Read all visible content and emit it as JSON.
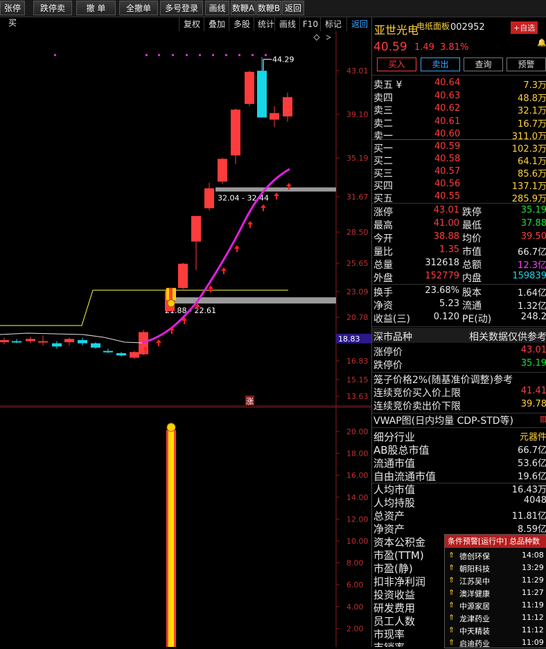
{
  "toolbar": [
    "张停买",
    "跌停卖",
    "撤 单",
    "全撤单",
    "多号登录",
    "画线",
    "数鞭A",
    "数鞭B",
    "返回"
  ],
  "subtoolbar": [
    "复权",
    "叠加",
    "多股",
    "统计",
    "画线",
    "F10",
    "标记",
    "返回"
  ],
  "chart_data": {
    "type": "candlestick",
    "y_ticks": [
      "43.01",
      "39.10",
      "35.19",
      "31.67",
      "28.50",
      "25.65",
      "23.09",
      "20.78",
      "18.70",
      "16.83",
      "15.15",
      "13.63"
    ],
    "current_price_tag": "18.83",
    "candles": [
      {
        "o": 18.5,
        "h": 18.9,
        "l": 18.3,
        "c": 18.7
      },
      {
        "o": 18.6,
        "h": 18.8,
        "l": 18.4,
        "c": 18.5
      },
      {
        "o": 18.6,
        "h": 19.0,
        "l": 18.4,
        "c": 18.8
      },
      {
        "o": 18.5,
        "h": 19.1,
        "l": 18.2,
        "c": 18.6
      },
      {
        "o": 18.4,
        "h": 18.6,
        "l": 17.9,
        "c": 18.1
      },
      {
        "o": 18.5,
        "h": 18.9,
        "l": 18.2,
        "c": 18.8
      },
      {
        "o": 18.7,
        "h": 18.9,
        "l": 18.2,
        "c": 18.4
      },
      {
        "o": 18.4,
        "h": 18.5,
        "l": 17.9,
        "c": 18.0
      },
      {
        "o": 17.7,
        "h": 17.9,
        "l": 17.5,
        "c": 17.6
      },
      {
        "o": 17.5,
        "h": 17.6,
        "l": 17.2,
        "c": 17.3
      },
      {
        "o": 17.1,
        "h": 17.7,
        "l": 17.0,
        "c": 17.6
      },
      {
        "o": 17.4,
        "h": 19.6,
        "l": 17.3,
        "c": 19.4
      },
      {
        "o": 21.3,
        "h": 23.4,
        "l": 21.3,
        "c": 23.3
      },
      {
        "o": 23.4,
        "h": 25.7,
        "l": 23.3,
        "c": 25.6
      },
      {
        "o": 27.6,
        "h": 29.9,
        "l": 25.0,
        "c": 29.9
      },
      {
        "o": 30.6,
        "h": 32.9,
        "l": 30.4,
        "c": 32.4
      },
      {
        "o": 33.0,
        "h": 35.2,
        "l": 32.8,
        "c": 35.1
      },
      {
        "o": 35.4,
        "h": 39.6,
        "l": 34.6,
        "c": 39.5
      },
      {
        "o": 40.0,
        "h": 43.0,
        "l": 39.8,
        "c": 42.9
      },
      {
        "o": 43.0,
        "h": 44.29,
        "l": 38.8,
        "c": 38.8
      },
      {
        "o": 38.6,
        "h": 39.8,
        "l": 37.9,
        "c": 39.2
      },
      {
        "o": 38.9,
        "h": 41.0,
        "l": 38.4,
        "c": 40.59
      }
    ],
    "boxes": [
      {
        "label": "32.04 - 32.44"
      },
      {
        "label": "21.88 - 22.61"
      }
    ],
    "high_label": "44.29",
    "zhang_marker": "涨",
    "volume_ticks": [
      "20.00",
      "18.00",
      "16.00",
      "14.00",
      "12.00",
      "10.00",
      "8.00",
      "6.00",
      "4.00",
      "2.00"
    ]
  },
  "stock": {
    "name": "亚世光电",
    "board": "电纸面板",
    "code": "002952",
    "add_label": "+自选",
    "price": "40.59",
    "change": "1.49",
    "pct": "3.81%"
  },
  "actions": [
    "买入",
    "卖出",
    "查询",
    "预警"
  ],
  "orderbook": {
    "asks": [
      {
        "label": "卖五 ¥",
        "price": "40.64",
        "vol": "7.3万"
      },
      {
        "label": "卖四",
        "price": "40.63",
        "vol": "48.8万"
      },
      {
        "label": "卖三",
        "price": "40.62",
        "vol": "32.1万"
      },
      {
        "label": "卖二",
        "price": "40.61",
        "vol": "16.7万"
      },
      {
        "label": "卖一",
        "price": "40.60",
        "vol": "311.0万"
      }
    ],
    "bids": [
      {
        "label": "买一",
        "price": "40.59",
        "vol": "102.3万"
      },
      {
        "label": "买二",
        "price": "40.58",
        "vol": "64.1万"
      },
      {
        "label": "买三",
        "price": "40.57",
        "vol": "85.6万"
      },
      {
        "label": "买四",
        "price": "40.56",
        "vol": "137.1万"
      },
      {
        "label": "买五",
        "price": "40.55",
        "vol": "285.9万"
      }
    ]
  },
  "stats": [
    {
      "l1": "涨停",
      "v1": "43.01",
      "l2": "跌停",
      "v2": "35.19"
    },
    {
      "l1": "最高",
      "v1": "41.00",
      "l2": "最低",
      "v2": "37.88"
    },
    {
      "l1": "今开",
      "v1": "38.88",
      "l2": "均价",
      "v2": "39.50"
    },
    {
      "l1": "量比",
      "v1": "1.35",
      "l2": "市值",
      "v2": "66.7亿"
    },
    {
      "l1": "总量",
      "v1": "312618",
      "l2": "总额",
      "v2": "12.3亿"
    },
    {
      "l1": "外盘",
      "v1": "152779",
      "l2": "内盘",
      "v2": "159839"
    }
  ],
  "stats2": [
    {
      "l1": "换手",
      "v1": "23.68%",
      "l2": "股本",
      "v2": "1.64亿"
    },
    {
      "l1": "净资",
      "v1": "5.23",
      "l2": "流通",
      "v2": "1.32亿"
    },
    {
      "l1": "收益(三)",
      "v1": "0.120",
      "l2": "PE(动)",
      "v2": "248.2"
    }
  ],
  "market": {
    "type": "深市品种",
    "note": "相关数据仅供参考"
  },
  "limits": [
    {
      "l": "涨停价",
      "v": "43.01"
    },
    {
      "l": "跌停价",
      "v": "35.19"
    }
  ],
  "cage": {
    "title": "笼子价格2%(随基准价调整)参考",
    "rows": [
      {
        "l": "连续竞价买入价上限",
        "v": "41.41"
      },
      {
        "l": "连续竞价卖出价下限",
        "v": "39.78"
      }
    ]
  },
  "vwap": "VWAP图(日内均量 CDP-STD等)",
  "fund": [
    {
      "l": "细分行业",
      "v": "元器件"
    },
    {
      "l": "AB股总市值",
      "v": "66.7亿"
    },
    {
      "l": "流通市值",
      "v": "53.6亿"
    },
    {
      "l": "自由流通市值",
      "v": "19.6亿"
    },
    {
      "l": "人均市值",
      "v": "16.43万"
    },
    {
      "l": "人均持股",
      "v": "4048"
    },
    {
      "l": "总资产",
      "v": "11.81亿"
    },
    {
      "l": "净资产",
      "v": "8.59亿"
    },
    {
      "l": "资本公积金",
      "v": ""
    },
    {
      "l": "市盈(TTM)",
      "v": ""
    },
    {
      "l": "市盈(静)",
      "v": ""
    },
    {
      "l": "扣非净利润",
      "v": ""
    },
    {
      "l": "投资收益",
      "v": ""
    },
    {
      "l": "研发费用",
      "v": ""
    },
    {
      "l": "员工人数",
      "v": ""
    },
    {
      "l": "市现率",
      "v": ""
    },
    {
      "l": "市销率",
      "v": ""
    }
  ],
  "popup": {
    "title": "条件预警[运行中] 总品种数",
    "rows": [
      {
        "name": "德创环保",
        "time": "14:08"
      },
      {
        "name": "朝阳科技",
        "time": "13:29"
      },
      {
        "name": "江苏吴中",
        "time": "11:29"
      },
      {
        "name": "澳洋健康",
        "time": "11:27"
      },
      {
        "name": "中源家居",
        "time": "11:19"
      },
      {
        "name": "龙津药业",
        "time": "11:12"
      },
      {
        "name": "中天精装",
        "time": "11:12"
      },
      {
        "name": "启迪药业",
        "time": "11:09"
      }
    ]
  }
}
